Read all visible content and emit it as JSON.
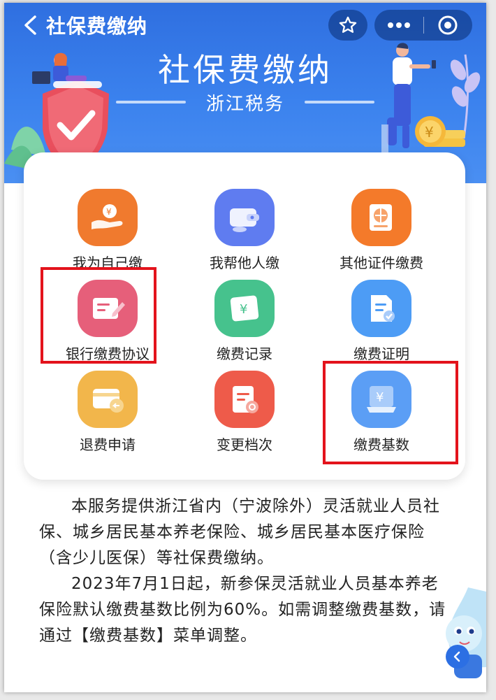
{
  "nav": {
    "title": "社保费缴纳"
  },
  "banner": {
    "title": "社保费缴纳",
    "subtitle": "浙江税务"
  },
  "menu": {
    "items": [
      {
        "label": "我为自己缴",
        "icon": "hand-coin-icon",
        "color": "#f07a2e"
      },
      {
        "label": "我帮他人缴",
        "icon": "wallet-icon",
        "color": "#5f7cf0"
      },
      {
        "label": "其他证件缴费",
        "icon": "globe-card-icon",
        "color": "#f47a2a"
      },
      {
        "label": "银行缴费协议",
        "icon": "sign-document-icon",
        "color": "#e65f7a"
      },
      {
        "label": "缴费记录",
        "icon": "bill-yen-icon",
        "color": "#46c28d"
      },
      {
        "label": "缴费证明",
        "icon": "certificate-check-icon",
        "color": "#4d9cf5"
      },
      {
        "label": "退费申请",
        "icon": "refund-card-icon",
        "color": "#f2b64b"
      },
      {
        "label": "变更档次",
        "icon": "document-change-icon",
        "color": "#ee5b4a"
      },
      {
        "label": "缴费基数",
        "icon": "yen-base-icon",
        "color": "#5b9ef5"
      }
    ],
    "highlight_color": "#e3131c"
  },
  "description": {
    "para1": "本服务提供浙江省内（宁波除外）灵活就业人员社保、城乡居民基本养老保险、城乡居民基本医疗保险（含少儿医保）等社保费缴纳。",
    "para2": "2023年7月1日起，新参保灵活就业人员基本养老保险默认缴费基数比例为60%。如需调整缴费基数，请通过【缴费基数】菜单调整。"
  },
  "colors": {
    "banner": "#3b82ee",
    "text": "#222222"
  }
}
